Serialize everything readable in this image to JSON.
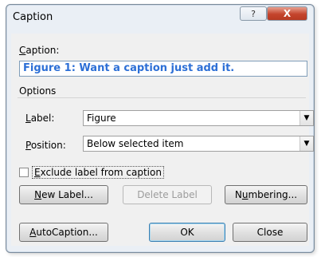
{
  "window": {
    "title": "Caption",
    "help_label": "?",
    "close_label": "X"
  },
  "caption": {
    "label_prefix": "C",
    "label_rest": "aption:",
    "value": "Figure 1: Want a caption just add it."
  },
  "options": {
    "heading": "Options",
    "label_field": {
      "prefix": "",
      "mnemonic": "L",
      "rest": "abel:",
      "value": "Figure"
    },
    "position_field": {
      "mnemonic": "P",
      "rest": "osition:",
      "value": "Below selected item"
    },
    "exclude": {
      "mnemonic": "E",
      "rest": "xclude label from caption",
      "checked": false
    }
  },
  "buttons": {
    "new_label": {
      "mnemonic": "N",
      "rest": "ew Label..."
    },
    "delete_label": "Delete Label",
    "numbering": {
      "prefix": "N",
      "mnemonic": "u",
      "rest": "mbering..."
    },
    "autocaption": {
      "prefix": "",
      "mnemonic": "A",
      "rest": "utoCaption..."
    },
    "ok": "OK",
    "close": "Close"
  },
  "icons": {
    "dropdown": "chevron-down-icon",
    "help": "help-icon",
    "close": "close-icon"
  }
}
